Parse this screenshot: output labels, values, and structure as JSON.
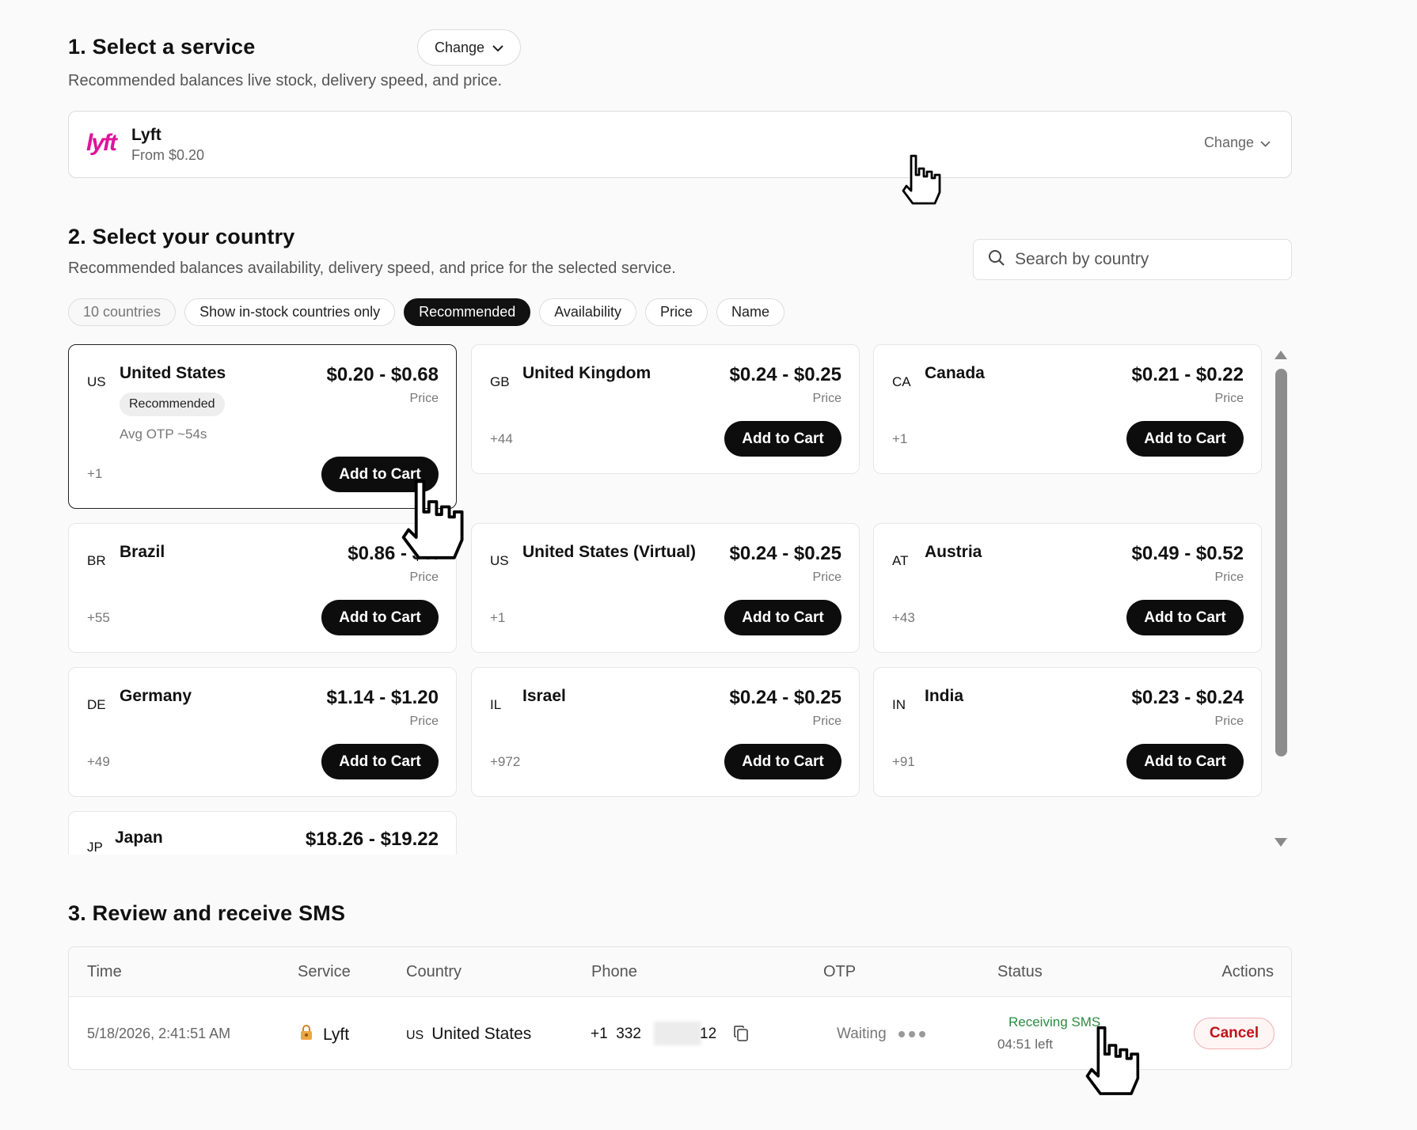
{
  "section1": {
    "title": "1. Select a service",
    "change_label": "Change",
    "subtitle": "Recommended balances live stock, delivery speed, and price.",
    "service": {
      "logo_text": "lyft",
      "name": "Lyft",
      "from": "From $0.20",
      "change_label": "Change",
      "brand_color": "#e0129b"
    }
  },
  "section2": {
    "title": "2. Select your country",
    "subtitle": "Recommended balances availability, delivery speed, and price for the selected service.",
    "search": {
      "placeholder": "Search by country",
      "value": ""
    },
    "chips": [
      {
        "label": "10 countries",
        "state": "muted"
      },
      {
        "label": "Show in-stock countries only",
        "state": "default"
      },
      {
        "label": "Recommended",
        "state": "active"
      },
      {
        "label": "Availability",
        "state": "default"
      },
      {
        "label": "Price",
        "state": "default"
      },
      {
        "label": "Name",
        "state": "default"
      }
    ],
    "price_label": "Price",
    "cart_label": "Add to Cart",
    "countries": [
      {
        "code": "US",
        "name": "United States",
        "price": "$0.20 - $0.68",
        "dial": "+1",
        "badge": "Recommended",
        "avg": "Avg OTP ~54s"
      },
      {
        "code": "GB",
        "name": "United Kingdom",
        "price": "$0.24 - $0.25",
        "dial": "+44"
      },
      {
        "code": "CA",
        "name": "Canada",
        "price": "$0.21 - $0.22",
        "dial": "+1"
      },
      {
        "code": "BR",
        "name": "Brazil",
        "price": "$0.86 - $0.",
        "dial": "+55"
      },
      {
        "code": "US",
        "name": "United States (Virtual)",
        "price": "$0.24 - $0.25",
        "dial": "+1"
      },
      {
        "code": "AT",
        "name": "Austria",
        "price": "$0.49 - $0.52",
        "dial": "+43"
      },
      {
        "code": "DE",
        "name": "Germany",
        "price": "$1.14 - $1.20",
        "dial": "+49"
      },
      {
        "code": "IL",
        "name": "Israel",
        "price": "$0.24 - $0.25",
        "dial": "+972"
      },
      {
        "code": "IN",
        "name": "India",
        "price": "$0.23 - $0.24",
        "dial": "+91"
      },
      {
        "code": "JP",
        "name": "Japan",
        "price": "$18.26 - $19.22",
        "dial": ""
      }
    ]
  },
  "section3": {
    "title": "3. Review and receive SMS",
    "headers": [
      "Time",
      "Service",
      "Country",
      "Phone",
      "OTP",
      "Status",
      "Actions"
    ],
    "row": {
      "time": "5/18/2026, 2:41:51 AM",
      "service": "Lyft",
      "country_code": "US",
      "country": "United States",
      "phone_prefix": "+1  332",
      "phone_suffix": "12",
      "otp": "Waiting",
      "status": "Receiving SMS",
      "time_left": "04:51 left",
      "action": "Cancel"
    }
  }
}
